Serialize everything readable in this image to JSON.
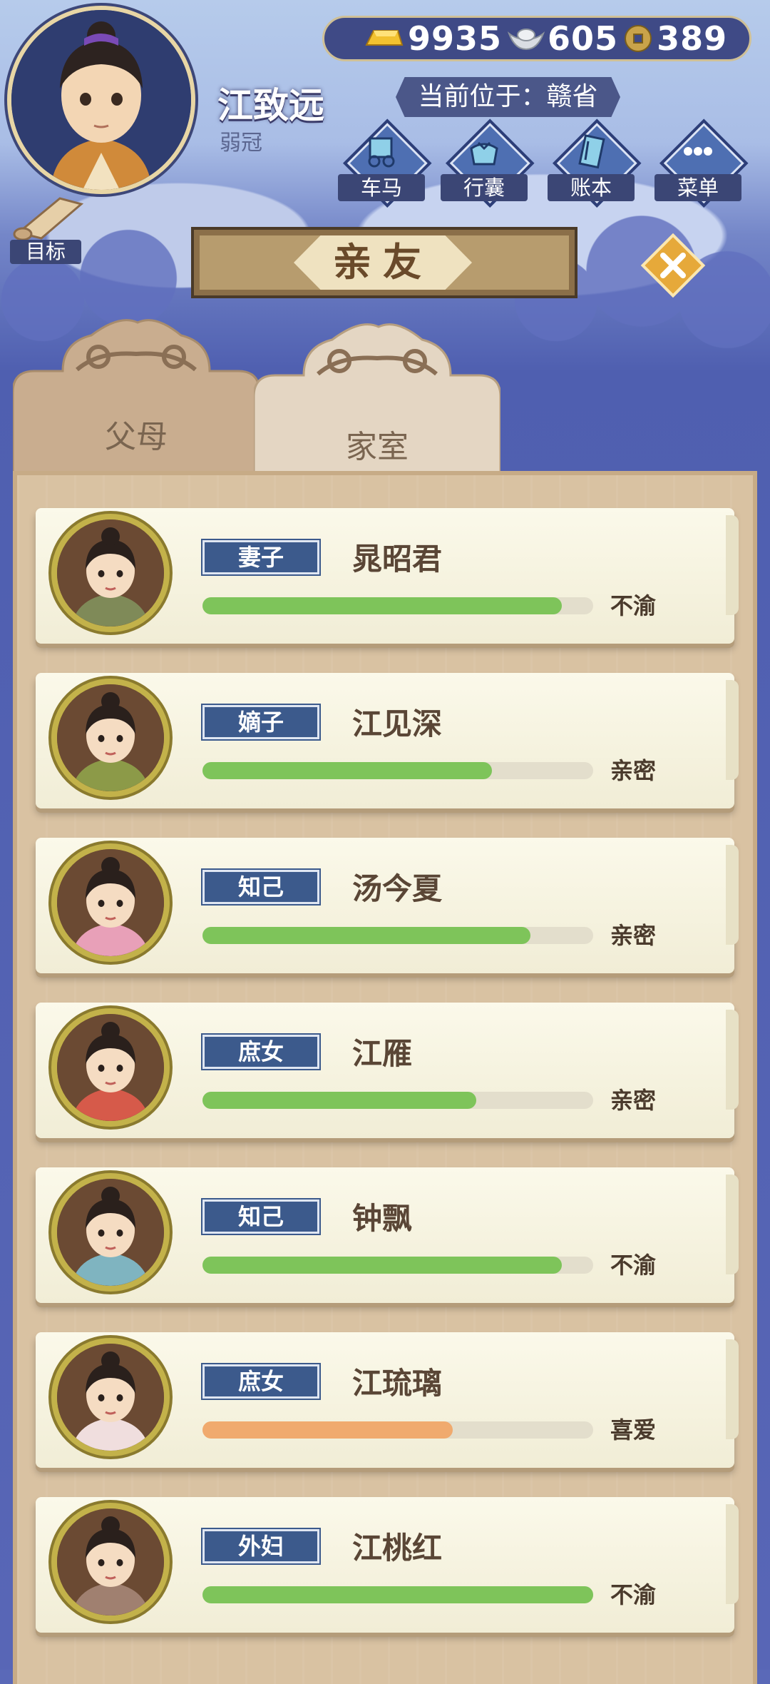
{
  "player": {
    "name": "江致远",
    "age_title": "弱冠",
    "location": "当前位于：赣省"
  },
  "currency": {
    "gold": "9935",
    "silver": "605",
    "coin": "389"
  },
  "nav": [
    {
      "label": "车马",
      "icon": "carriage-icon"
    },
    {
      "label": "行囊",
      "icon": "bundle-icon"
    },
    {
      "label": "账本",
      "icon": "ledger-icon"
    },
    {
      "label": "菜单",
      "icon": "menu-dots-icon"
    }
  ],
  "goal": {
    "label": "目标",
    "icon": "scroll-icon"
  },
  "title": "亲友",
  "tabs": [
    {
      "label": "父母",
      "active": false
    },
    {
      "label": "家室",
      "active": true
    }
  ],
  "relatives": [
    {
      "relation": "妻子",
      "name": "晁昭君",
      "status": "不渝",
      "affection": 0.92,
      "bar_color": "#7ec45a"
    },
    {
      "relation": "嫡子",
      "name": "江见深",
      "status": "亲密",
      "affection": 0.74,
      "bar_color": "#7ec45a"
    },
    {
      "relation": "知己",
      "name": "汤今夏",
      "status": "亲密",
      "affection": 0.84,
      "bar_color": "#7ec45a"
    },
    {
      "relation": "庶女",
      "name": "江雁",
      "status": "亲密",
      "affection": 0.7,
      "bar_color": "#7ec45a"
    },
    {
      "relation": "知己",
      "name": "钟飘",
      "status": "不渝",
      "affection": 0.92,
      "bar_color": "#7ec45a"
    },
    {
      "relation": "庶女",
      "name": "江琉璃",
      "status": "喜爱",
      "affection": 0.64,
      "bar_color": "#f0aa6e"
    },
    {
      "relation": "外妇",
      "name": "江桃红",
      "status": "不渝",
      "affection": 1.0,
      "bar_color": "#7ec45a"
    }
  ],
  "colors": {
    "relation_tag": "#3c5a8c",
    "bar_green": "#7ec45a",
    "bar_orange": "#f0aa6e"
  }
}
